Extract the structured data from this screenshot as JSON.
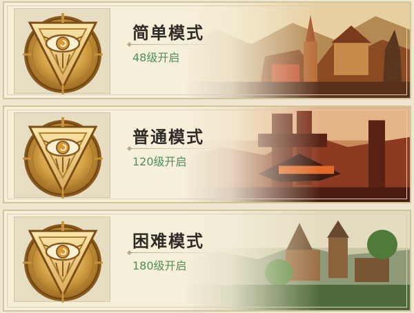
{
  "modes": [
    {
      "title": "简单模式",
      "unlock": "48级开启"
    },
    {
      "title": "普通模式",
      "unlock": "120级开启"
    },
    {
      "title": "困难模式",
      "unlock": "180级开启"
    }
  ]
}
